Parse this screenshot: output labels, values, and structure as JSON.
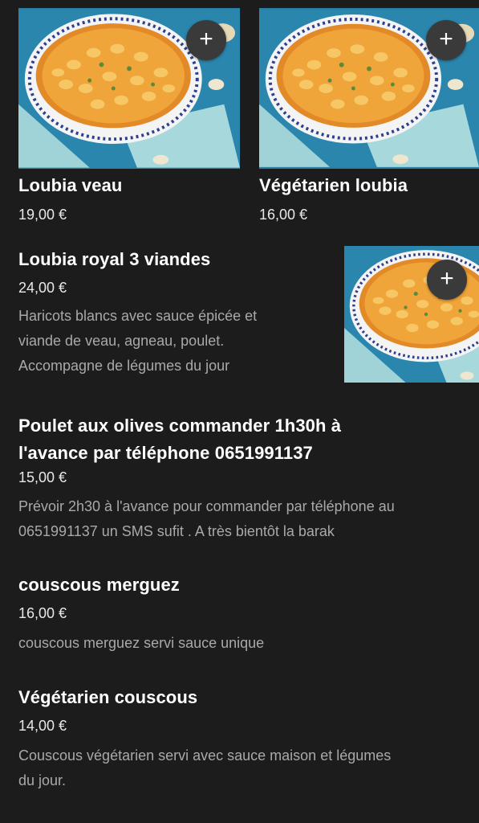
{
  "items": [
    {
      "name": "Loubia veau",
      "price": "19,00 €",
      "add_label": "+"
    },
    {
      "name": "Végétarien loubia",
      "price": "16,00 €",
      "add_label": "+"
    },
    {
      "name": "Loubia royal 3 viandes",
      "price": "24,00 €",
      "description": [
        "Haricots blancs avec sauce épicée et",
        "viande de veau, agneau, poulet.",
        "Accompagne de légumes du jour"
      ],
      "add_label": "+"
    },
    {
      "name_lines": [
        "Poulet aux olives commander 1h30h à",
        "l'avance par téléphone 0651991137"
      ],
      "price": "15,00 €",
      "description": [
        "Prévoir 2h30 à l'avance pour commander par téléphone au",
        "0651991137 un SMS sufit . A très bientôt la barak"
      ]
    },
    {
      "name": "couscous merguez",
      "price": "16,00 €",
      "description": [
        "couscous merguez servi sauce unique"
      ]
    },
    {
      "name": "Végétarien couscous",
      "price": "14,00 €",
      "description": [
        "Couscous végétarien servi avec sauce maison et légumes",
        "du jour."
      ]
    }
  ],
  "colors": {
    "background": "#1c1c1c",
    "text": "#ffffff",
    "muted": "#a9a9a9",
    "add_button": "#3a3a3a"
  },
  "icons": {
    "add": "plus-icon"
  }
}
